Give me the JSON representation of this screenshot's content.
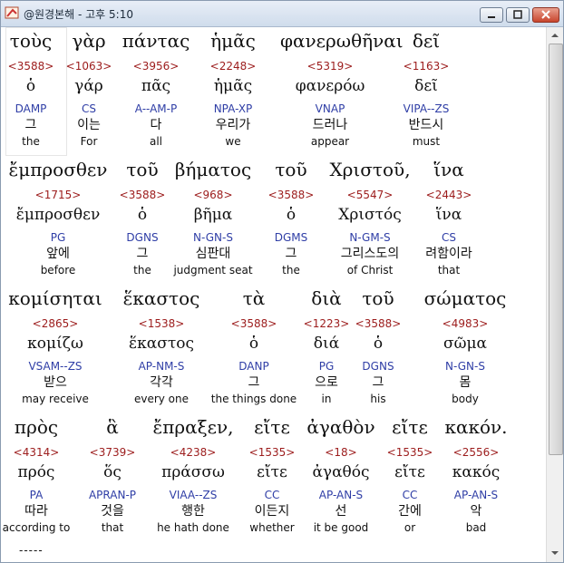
{
  "window": {
    "title": "@원경본해 - 고후 5:10",
    "icons": {
      "app": "bible-app-icon",
      "minimize": "minimize-icon",
      "maximize": "maximize-icon",
      "close": "close-icon"
    }
  },
  "interlinear": {
    "rows": [
      {
        "words": [
          {
            "greek": "τοὺς",
            "strongs": "<3588>",
            "lexeme": "ὁ",
            "parsing": "DAMP",
            "korean": "그",
            "english": "the"
          },
          {
            "greek": "γὰρ",
            "strongs": "<1063>",
            "lexeme": "γάρ",
            "parsing": "CS",
            "korean": "이는",
            "english": "For"
          },
          {
            "greek": "πάντας",
            "strongs": "<3956>",
            "lexeme": "πᾶς",
            "parsing": "A--AM-P",
            "korean": "다",
            "english": "all"
          },
          {
            "greek": "ἡμᾶς",
            "strongs": "<2248>",
            "lexeme": "ἡμᾶς",
            "parsing": "NPA-XP",
            "korean": "우리가",
            "english": "we"
          },
          {
            "greek": "φανερωθῆναι",
            "strongs": "<5319>",
            "lexeme": "φανερόω",
            "parsing": "VNAP",
            "korean": "드러나",
            "english": "appear"
          },
          {
            "greek": "δεῖ",
            "strongs": "<1163>",
            "lexeme": "δεῖ",
            "parsing": "VIPA--ZS",
            "korean": "반드시",
            "english": "must"
          }
        ]
      },
      {
        "words": [
          {
            "greek": "ἔμπροσθεν",
            "strongs": "<1715>",
            "lexeme": "ἔμπροσθεν",
            "parsing": "PG",
            "korean": "앞에",
            "english": "before"
          },
          {
            "greek": "τοῦ",
            "strongs": "<3588>",
            "lexeme": "ὁ",
            "parsing": "DGNS",
            "korean": "그",
            "english": "the"
          },
          {
            "greek": "βήματος",
            "strongs": "<968>",
            "lexeme": "βῆμα",
            "parsing": "N-GN-S",
            "korean": "심판대",
            "english": "judgment seat"
          },
          {
            "greek": "τοῦ",
            "strongs": "<3588>",
            "lexeme": "ὁ",
            "parsing": "DGMS",
            "korean": "그",
            "english": "the"
          },
          {
            "greek": "Χριστοῦ,",
            "strongs": "<5547>",
            "lexeme": "Χριστός",
            "parsing": "N-GM-S",
            "korean": "그리스도의",
            "english": "of Christ"
          },
          {
            "greek": "ἵνα",
            "strongs": "<2443>",
            "lexeme": "ἵνα",
            "parsing": "CS",
            "korean": "려함이라",
            "english": "that"
          }
        ]
      },
      {
        "words": [
          {
            "greek": "κομίσηται",
            "strongs": "<2865>",
            "lexeme": "κομίζω",
            "parsing": "VSAM--ZS",
            "korean": "받으",
            "english": "may receive"
          },
          {
            "greek": "ἕκαστος",
            "strongs": "<1538>",
            "lexeme": "ἕκαστος",
            "parsing": "AP-NM-S",
            "korean": "각각",
            "english": "every one"
          },
          {
            "greek": "τὰ",
            "strongs": "<3588>",
            "lexeme": "ὁ",
            "parsing": "DANP",
            "korean": "그",
            "english": "the things done"
          },
          {
            "greek": "διὰ",
            "strongs": "<1223>",
            "lexeme": "διά",
            "parsing": "PG",
            "korean": "으로",
            "english": "in"
          },
          {
            "greek": "τοῦ",
            "strongs": "<3588>",
            "lexeme": "ὁ",
            "parsing": "DGNS",
            "korean": "그",
            "english": "his"
          },
          {
            "greek": "σώματος",
            "strongs": "<4983>",
            "lexeme": "σῶμα",
            "parsing": "N-GN-S",
            "korean": "몸",
            "english": "body"
          }
        ]
      },
      {
        "words": [
          {
            "greek": "πρὸς",
            "strongs": "<4314>",
            "lexeme": "πρός",
            "parsing": "PA",
            "korean": "따라",
            "english": "according to"
          },
          {
            "greek": "ἃ",
            "strongs": "<3739>",
            "lexeme": "ὅς",
            "parsing": "APRAN-P",
            "korean": "것을",
            "english": "that"
          },
          {
            "greek": "ἔπραξεν,",
            "strongs": "<4238>",
            "lexeme": "πράσσω",
            "parsing": "VIAA--ZS",
            "korean": "행한",
            "english": "he hath done"
          },
          {
            "greek": "εἴτε",
            "strongs": "<1535>",
            "lexeme": "εἴτε",
            "parsing": "CC",
            "korean": "이든지",
            "english": "whether"
          },
          {
            "greek": "ἀγαθὸν",
            "strongs": "<18>",
            "lexeme": "ἀγαθός",
            "parsing": "AP-AN-S",
            "korean": "선",
            "english": "it be good"
          },
          {
            "greek": "εἴτε",
            "strongs": "<1535>",
            "lexeme": "εἴτε",
            "parsing": "CC",
            "korean": "간에",
            "english": "or"
          },
          {
            "greek": "κακόν.",
            "strongs": "<2556>",
            "lexeme": "κακός",
            "parsing": "AP-AN-S",
            "korean": "악",
            "english": "bad"
          }
        ]
      }
    ],
    "footer_marker": "-----"
  },
  "scrollbar": {
    "up_icon": "scroll-up-arrow-icon",
    "down_icon": "scroll-down-arrow-icon"
  }
}
